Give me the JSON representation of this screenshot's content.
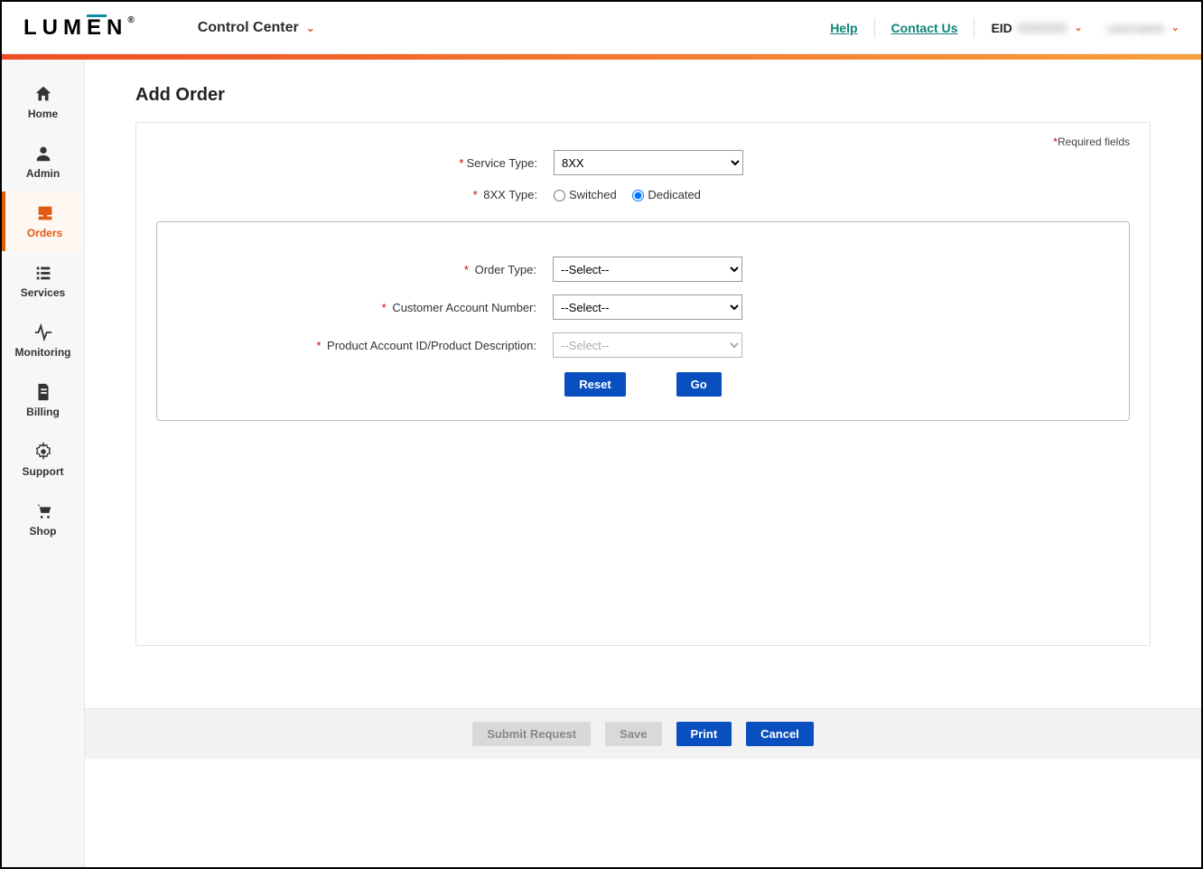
{
  "header": {
    "logo_text": "LUMEN",
    "app_title": "Control Center",
    "help": "Help",
    "contact": "Contact Us",
    "eid_label": "EID"
  },
  "sidebar": {
    "items": [
      {
        "label": "Home"
      },
      {
        "label": "Admin"
      },
      {
        "label": "Orders"
      },
      {
        "label": "Services"
      },
      {
        "label": "Monitoring"
      },
      {
        "label": "Billing"
      },
      {
        "label": "Support"
      },
      {
        "label": "Shop"
      }
    ]
  },
  "page": {
    "title": "Add Order",
    "required_note": "Required fields"
  },
  "form": {
    "service_type_label": "Service Type:",
    "service_type_value": "8XX",
    "eightxx_type_label": "8XX Type:",
    "radio_switched": "Switched",
    "radio_dedicated": "Dedicated",
    "radio_selected": "dedicated",
    "order_type_label": "Order Type:",
    "order_type_value": "--Select--",
    "customer_account_label": "Customer Account Number:",
    "customer_account_value": "--Select--",
    "product_account_label": "Product Account ID/Product Description:",
    "product_account_value": "--Select--",
    "reset_btn": "Reset",
    "go_btn": "Go"
  },
  "footer": {
    "submit": "Submit Request",
    "save": "Save",
    "print": "Print",
    "cancel": "Cancel"
  }
}
